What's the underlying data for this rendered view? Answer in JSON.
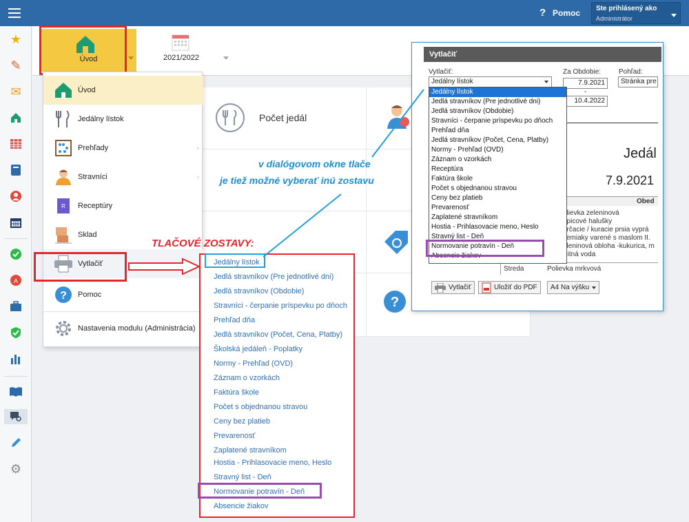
{
  "topbar": {
    "help_label": "Pomoc",
    "help_icon": "?",
    "user_title": "Ste prihlásený ako",
    "user_name": "Administrátor"
  },
  "tabs": {
    "home_label": "Úvod",
    "year_label": "2021/2022"
  },
  "menu": [
    {
      "label": "Úvod",
      "icon": "home-icon"
    },
    {
      "label": "Jedálny lístok",
      "icon": "cutlery-icon"
    },
    {
      "label": "Prehľady",
      "icon": "abacus-icon"
    },
    {
      "label": "Stravníci",
      "icon": "person-icon"
    },
    {
      "label": "Receptúry",
      "icon": "book-icon"
    },
    {
      "label": "Sklad",
      "icon": "boxes-icon"
    },
    {
      "label": "Vytlačiť",
      "icon": "printer-icon"
    },
    {
      "label": "Pomoc",
      "icon": "help-icon"
    },
    {
      "label": "Nastavenia modulu (Administrácia)",
      "icon": "gear-icon"
    }
  ],
  "main": {
    "tile_count_label": "Počet jedál"
  },
  "annotations": {
    "zostavy": "TLAČOVÉ ZOSTAVY:",
    "line1": "v dialógovom okne tlače",
    "line2": "je tiež možné vyberať inú zostavu"
  },
  "reports": [
    "Jedálny lístok",
    "Jedlá stravníkov (Pre jednotlivé dni)",
    "Jedlá stravníkov (Obdobie)",
    "Stravníci - čerpanie príspevku po dňoch",
    "Prehľad dňa",
    "Jedlá stravníkov (Počet, Cena, Platby)",
    "Školská jedáleň - Poplatky",
    "Normy - Prehľad (OVD)",
    "Záznam o vzorkách",
    "Faktúra škole",
    "Počet s objednanou stravou",
    "Ceny bez platieb",
    "Prevarenosť",
    "Zaplatené stravníkom",
    "Hostia - Prihlasovacie meno, Heslo",
    "Stravný list - Deň",
    "Normovanie potravín - Deň",
    "Absencie žiakov"
  ],
  "dialog": {
    "title": "Vytlačiť",
    "print_label": "Vytlačiť:",
    "print_value": "Jedálny lístok",
    "period_label": "Za Obdobie:",
    "date_from": "7.9.2021",
    "date_sep": "-",
    "date_to": "10.4.2022",
    "view_label": "Pohľad:",
    "view_value": "Stránka pre",
    "options": [
      "Jedálny lístok",
      "Jedlá stravníkov (Pre jednotlivé dni)",
      "Jedlá stravníkov (Obdobie)",
      "Stravníci - čerpanie príspevku po dňoch",
      "Prehľad dňa",
      "Jedlá stravníkov (Počet, Cena, Platby)",
      "Normy - Prehľad (OVD)",
      "Záznam o vzorkách",
      "Receptúra",
      "Faktúra škole",
      "Počet s objednanou stravou",
      "Ceny bez platieb",
      "Prevarenosť",
      "Zaplatené stravníkom",
      "Hostia - Prihlasovacie meno, Heslo",
      "Stravný list - Deň",
      "Normovanie potravín - Deň",
      "Absencie žiakov"
    ],
    "preview_title": "Jedál",
    "preview_date": "7.9.2021",
    "preview_col": "Obed",
    "preview_lines": [
      "olievka zeleninová",
      "upicové halušky",
      "určacie / kuracie prsia vyprá",
      "zemiaky varené s maslom II.",
      "eleninová obloha -kukurica, m",
      "Pitná voda"
    ],
    "preview_day": "Streda",
    "preview_soup": "Polievka mrkvová",
    "btn_print": "Vytlačiť",
    "btn_pdf": "Uložiť do PDF",
    "btn_page": "A4 Na výšku"
  },
  "colors": {
    "topbar": "#2e6aa8",
    "tab_active": "#f5c842",
    "annot_red": "#e3262e",
    "annot_blue": "#1a8fd6",
    "annot_purple": "#9b4ab0"
  }
}
